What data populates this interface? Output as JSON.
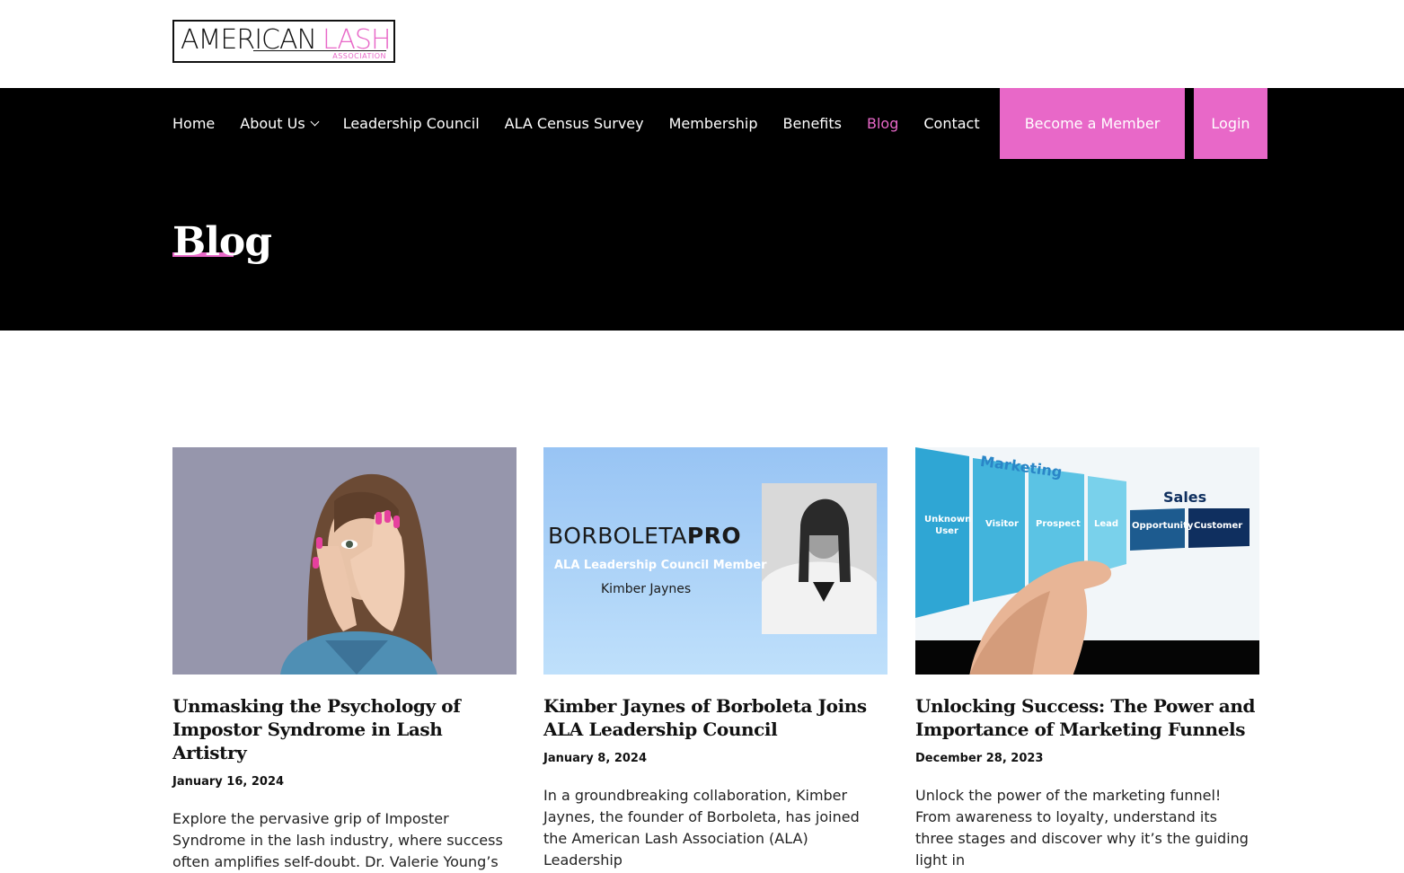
{
  "logo": {
    "part1": "AMERICAN",
    "part2": "LASH",
    "tagline": "ASSOCIATION"
  },
  "nav": {
    "items": [
      {
        "label": "Home"
      },
      {
        "label": "About Us"
      },
      {
        "label": "Leadership Council"
      },
      {
        "label": "ALA Census Survey"
      },
      {
        "label": "Membership"
      },
      {
        "label": "Benefits"
      },
      {
        "label": "Blog"
      },
      {
        "label": "Contact"
      }
    ],
    "become_member": "Become a Member",
    "login": "Login"
  },
  "page": {
    "title": "Blog"
  },
  "posts": [
    {
      "title": "Unmasking the Psychology of Impostor Syndrome in Lash Artistry",
      "date": "January 16, 2024",
      "excerpt": "Explore the pervasive grip of Imposter Syndrome in the lash industry, where success often amplifies self-doubt. Dr. Valerie Young’s"
    },
    {
      "title": "Kimber Jaynes of Borboleta Joins ALA Leadership Council",
      "date": "January 8, 2024",
      "excerpt": "In a groundbreaking collaboration, Kimber Jaynes, the founder of Borboleta, has joined the American Lash Association (ALA) Leadership",
      "image_text": {
        "brand_a": "BORBOLETA",
        "brand_b": "PRO",
        "subtitle": "ALA Leadership Council Member",
        "name": "Kimber Jaynes"
      }
    },
    {
      "title": "Unlocking Success: The Power and Importance of Marketing Funnels",
      "date": "December 28, 2023",
      "excerpt": "Unlock the power of the marketing funnel! From awareness to loyalty, understand its three stages and discover why it’s the guiding light in",
      "image_text": {
        "marketing": "Marketing",
        "sales": "Sales",
        "stages": [
          "Unknown User",
          "Visitor",
          "Prospect",
          "Lead",
          "Opportunity",
          "Customer"
        ]
      }
    }
  ]
}
